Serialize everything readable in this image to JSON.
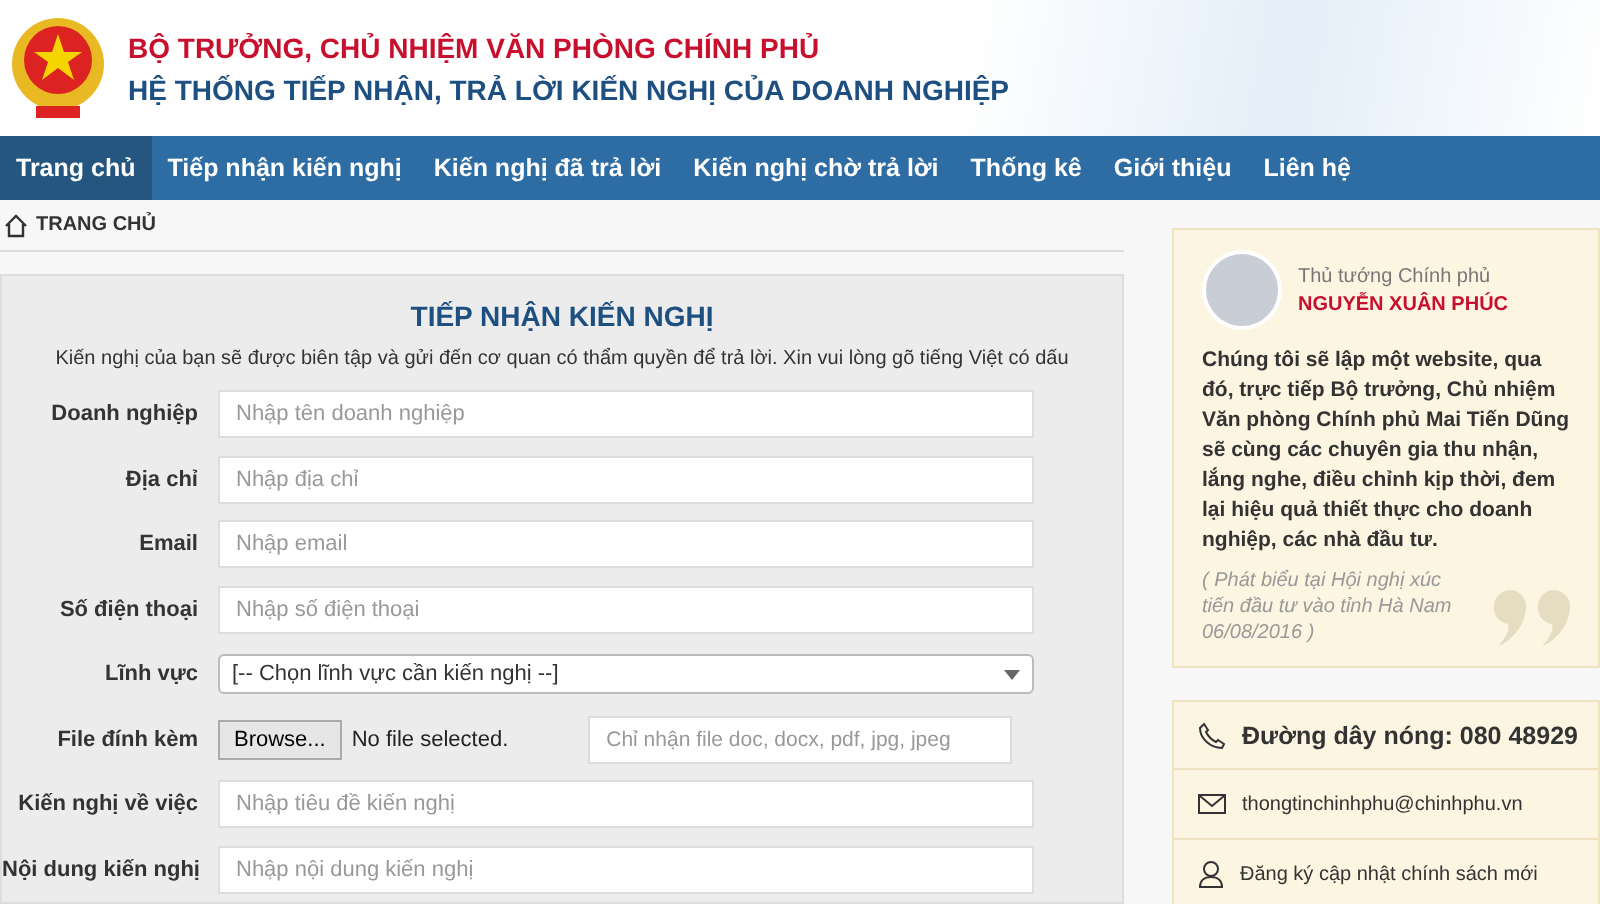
{
  "header": {
    "title": "BỘ TRƯỞNG, CHỦ NHIỆM VĂN PHÒNG CHÍNH PHỦ",
    "subtitle": "HỆ THỐNG TIẾP NHẬN, TRẢ LỜI KIẾN NGHỊ CỦA DOANH NGHIỆP"
  },
  "nav": [
    {
      "label": "Trang chủ",
      "selected": true
    },
    {
      "label": "Tiếp nhận kiến nghị",
      "selected": false
    },
    {
      "label": "Kiến nghị đã trả lời",
      "selected": false
    },
    {
      "label": "Kiến nghị chờ trả lời",
      "selected": false
    },
    {
      "label": "Thống kê",
      "selected": false
    },
    {
      "label": "Giới thiệu",
      "selected": false
    },
    {
      "label": "Liên hệ",
      "selected": false
    }
  ],
  "breadcrumb": "TRANG CHỦ",
  "form": {
    "title": "TIẾP NHẬN KIẾN NGHỊ",
    "intro": "Kiến nghị của bạn sẽ được biên tập và gửi đến cơ quan có thẩm quyền để trả lời. Xin vui lòng gõ tiếng Việt có dấu",
    "fields": [
      {
        "kind": "text",
        "label": "Doanh nghiệp",
        "placeholder": "Nhập tên doanh nghiệp"
      },
      {
        "kind": "text",
        "label": "Địa chỉ",
        "placeholder": "Nhập địa chỉ"
      },
      {
        "kind": "text",
        "label": "Email",
        "placeholder": "Nhập email"
      },
      {
        "kind": "text",
        "label": "Số điện thoại",
        "placeholder": "Nhập số điện thoại"
      },
      {
        "kind": "select",
        "label": "Lĩnh vực",
        "value": "[-- Chọn lĩnh vực cần kiến nghị --]"
      },
      {
        "kind": "file",
        "label": "File đính kèm",
        "button": "Browse...",
        "status": "No file selected.",
        "placeholder": "Chỉ nhận file doc, docx, pdf, jpg, jpeg"
      },
      {
        "kind": "text",
        "label": "Kiến nghị về việc",
        "placeholder": "Nhập tiêu đề kiến nghị"
      },
      {
        "kind": "text",
        "label": "Nội dung kiến nghị",
        "placeholder": "Nhập nội dung kiến nghị"
      }
    ]
  },
  "quote": {
    "role": "Thủ tướng Chính phủ",
    "name": "NGUYỄN XUÂN PHÚC",
    "text": "Chúng tôi sẽ lập một website, qua đó, trực tiếp Bộ trưởng, Chủ nhiệm Văn phòng Chính phủ Mai Tiến Dũng sẽ cùng các chuyên gia thu nhận, lắng nghe, điều chỉnh kịp thời, đem lại hiệu quả thiết thực cho doanh nghiệp, các nhà đầu tư.",
    "source": "( Phát biểu tại Hội nghị xúc tiến đầu tư vào tỉnh Hà Nam 06/08/2016 )"
  },
  "contacts": [
    {
      "kind": "phone",
      "text": "Đường dây nóng: 080 48929"
    },
    {
      "kind": "mail",
      "text": "thongtinchinhphu@chinhphu.vn"
    },
    {
      "kind": "user",
      "text": "Đăng ký cập nhật chính sách mới"
    }
  ]
}
